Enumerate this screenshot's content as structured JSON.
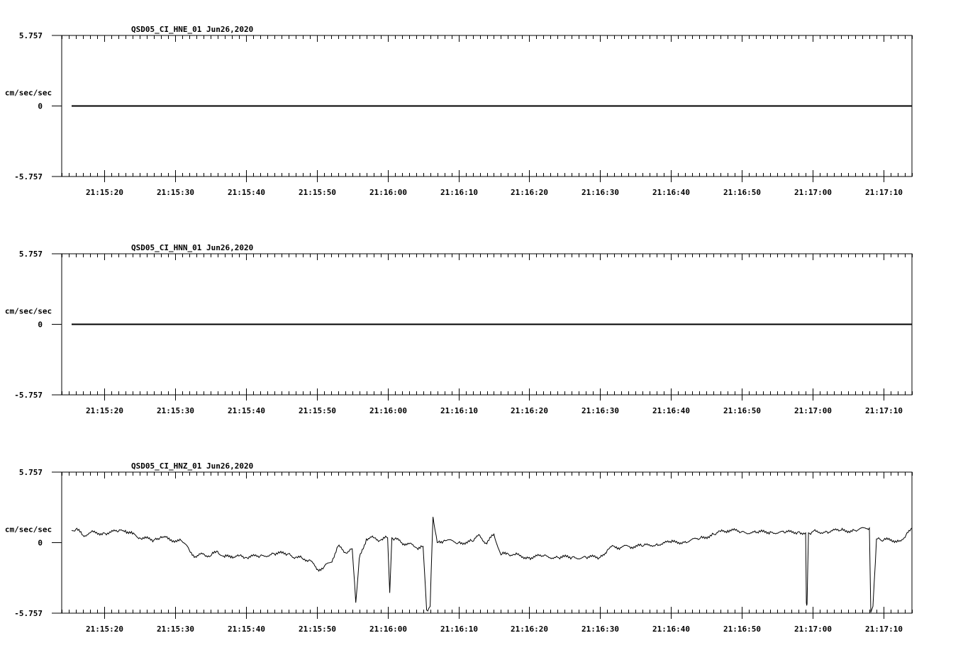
{
  "chart_data": [
    {
      "type": "line",
      "title": "QSD05_CI_HNE_01  Jun26,2020",
      "ylabel": "cm/sec/sec",
      "ylim": [
        -5.757,
        5.757
      ],
      "ytick_labels": [
        "5.757",
        "0",
        "-5.757"
      ],
      "xlim": [
        "21:15:14",
        "21:17:14"
      ],
      "xtick_labels": [
        "21:15:20",
        "21:15:30",
        "21:15:40",
        "21:15:50",
        "21:16:00",
        "21:16:10",
        "21:16:20",
        "21:16:30",
        "21:16:40",
        "21:16:50",
        "21:17:00",
        "21:17:10"
      ],
      "series": [
        {
          "x": [
            "21:15:15.4",
            "21:17:14"
          ],
          "y": [
            0,
            0
          ]
        }
      ]
    },
    {
      "type": "line",
      "title": "QSD05_CI_HNN_01  Jun26,2020",
      "ylabel": "cm/sec/sec",
      "ylim": [
        -5.757,
        5.757
      ],
      "ytick_labels": [
        "5.757",
        "0",
        "-5.757"
      ],
      "xlim": [
        "21:15:14",
        "21:17:14"
      ],
      "xtick_labels": [
        "21:15:20",
        "21:15:30",
        "21:15:40",
        "21:15:50",
        "21:16:00",
        "21:16:10",
        "21:16:20",
        "21:16:30",
        "21:16:40",
        "21:16:50",
        "21:17:00",
        "21:17:10"
      ],
      "series": [
        {
          "x": [
            "21:15:15.4",
            "21:17:14"
          ],
          "y": [
            0,
            0
          ]
        }
      ]
    },
    {
      "type": "line",
      "title": "QSD05_CI_HNZ_01  Jun26,2020",
      "ylabel": "cm/sec/sec",
      "ylim": [
        -5.757,
        5.757
      ],
      "ytick_labels": [
        "5.757",
        "0",
        "-5.757"
      ],
      "xlim": [
        "21:15:14",
        "21:17:14"
      ],
      "xtick_labels": [
        "21:15:20",
        "21:15:30",
        "21:15:40",
        "21:15:50",
        "21:16:00",
        "21:16:10",
        "21:16:20",
        "21:16:30",
        "21:16:40",
        "21:16:50",
        "21:17:00",
        "21:17:10"
      ],
      "series": [
        {
          "x": [
            "21:15:15.4",
            "21:15:16",
            "21:15:17",
            "21:15:18",
            "21:15:20",
            "21:15:22",
            "21:15:23",
            "21:15:24",
            "21:15:25",
            "21:15:27",
            "21:15:28",
            "21:15:29",
            "21:15:31",
            "21:15:32",
            "21:15:33",
            "21:15:34",
            "21:15:35",
            "21:15:36",
            "21:15:37",
            "21:15:38",
            "21:15:39",
            "21:15:40",
            "21:15:42",
            "21:15:44",
            "21:15:46",
            "21:15:47",
            "21:15:48",
            "21:15:49",
            "21:15:50",
            "21:15:51",
            "21:15:52",
            "21:15:53",
            "21:15:54",
            "21:15:55",
            "21:15:55.5",
            "21:15:56",
            "21:15:57",
            "21:15:58",
            "21:15:59",
            "21:16:00",
            "21:16:00.3",
            "21:16:00.6",
            "21:16:01",
            "21:16:02",
            "21:16:03",
            "21:16:04",
            "21:16:05",
            "21:16:05.5",
            "21:16:06",
            "21:16:06.4",
            "21:16:07",
            "21:16:08",
            "21:16:10",
            "21:16:12",
            "21:16:13",
            "21:16:14",
            "21:16:15",
            "21:16:16",
            "21:16:17",
            "21:16:18",
            "21:16:20",
            "21:16:22",
            "21:16:24",
            "21:16:26",
            "21:16:28",
            "21:16:30",
            "21:16:31",
            "21:16:32",
            "21:16:33",
            "21:16:34",
            "21:16:36",
            "21:16:38",
            "21:16:40",
            "21:16:42",
            "21:16:44",
            "21:16:46",
            "21:16:47",
            "21:16:48",
            "21:16:50",
            "21:16:52",
            "21:16:54",
            "21:16:56",
            "21:16:58",
            "21:16:59",
            "21:16:59.1",
            "21:16:59.2",
            "21:16:59.4",
            "21:17:00",
            "21:17:02",
            "21:17:04",
            "21:17:06",
            "21:17:08",
            "21:17:08.2",
            "21:17:08.5",
            "21:17:09",
            "21:17:09.3",
            "21:17:10",
            "21:17:12",
            "21:17:13",
            "21:17:14"
          ],
          "y": [
            1.0,
            1.1,
            0.6,
            0.8,
            0.8,
            0.9,
            1.0,
            0.7,
            0.4,
            0.2,
            0.5,
            0.3,
            0.1,
            -0.6,
            -1.2,
            -0.9,
            -1.1,
            -0.7,
            -1.2,
            -1.1,
            -1.1,
            -1.2,
            -1.1,
            -0.9,
            -0.9,
            -1.2,
            -1.3,
            -1.4,
            -2.2,
            -2.0,
            -1.6,
            -0.3,
            -0.8,
            -0.5,
            -4.9,
            -1.3,
            0.3,
            0.4,
            0.2,
            0.4,
            -4.1,
            0.4,
            0.3,
            0.0,
            -0.1,
            -0.4,
            -0.3,
            -5.5,
            -5.2,
            2.1,
            0.0,
            0.2,
            0.0,
            0.1,
            0.6,
            -0.1,
            0.7,
            -1.0,
            -0.9,
            -1.0,
            -1.2,
            -1.1,
            -1.2,
            -1.2,
            -1.2,
            -1.2,
            -0.6,
            -0.3,
            -0.4,
            -0.3,
            -0.3,
            -0.1,
            0.0,
            0.1,
            0.3,
            0.7,
            0.9,
            1.0,
            0.9,
            0.8,
            0.9,
            0.8,
            0.9,
            0.8,
            -4.9,
            -5.0,
            0.8,
            0.9,
            0.9,
            1.0,
            1.0,
            1.2,
            -5.7,
            -5.2,
            0.3,
            0.4,
            0.2,
            0.2,
            0.4,
            1.2
          ]
        }
      ]
    }
  ]
}
